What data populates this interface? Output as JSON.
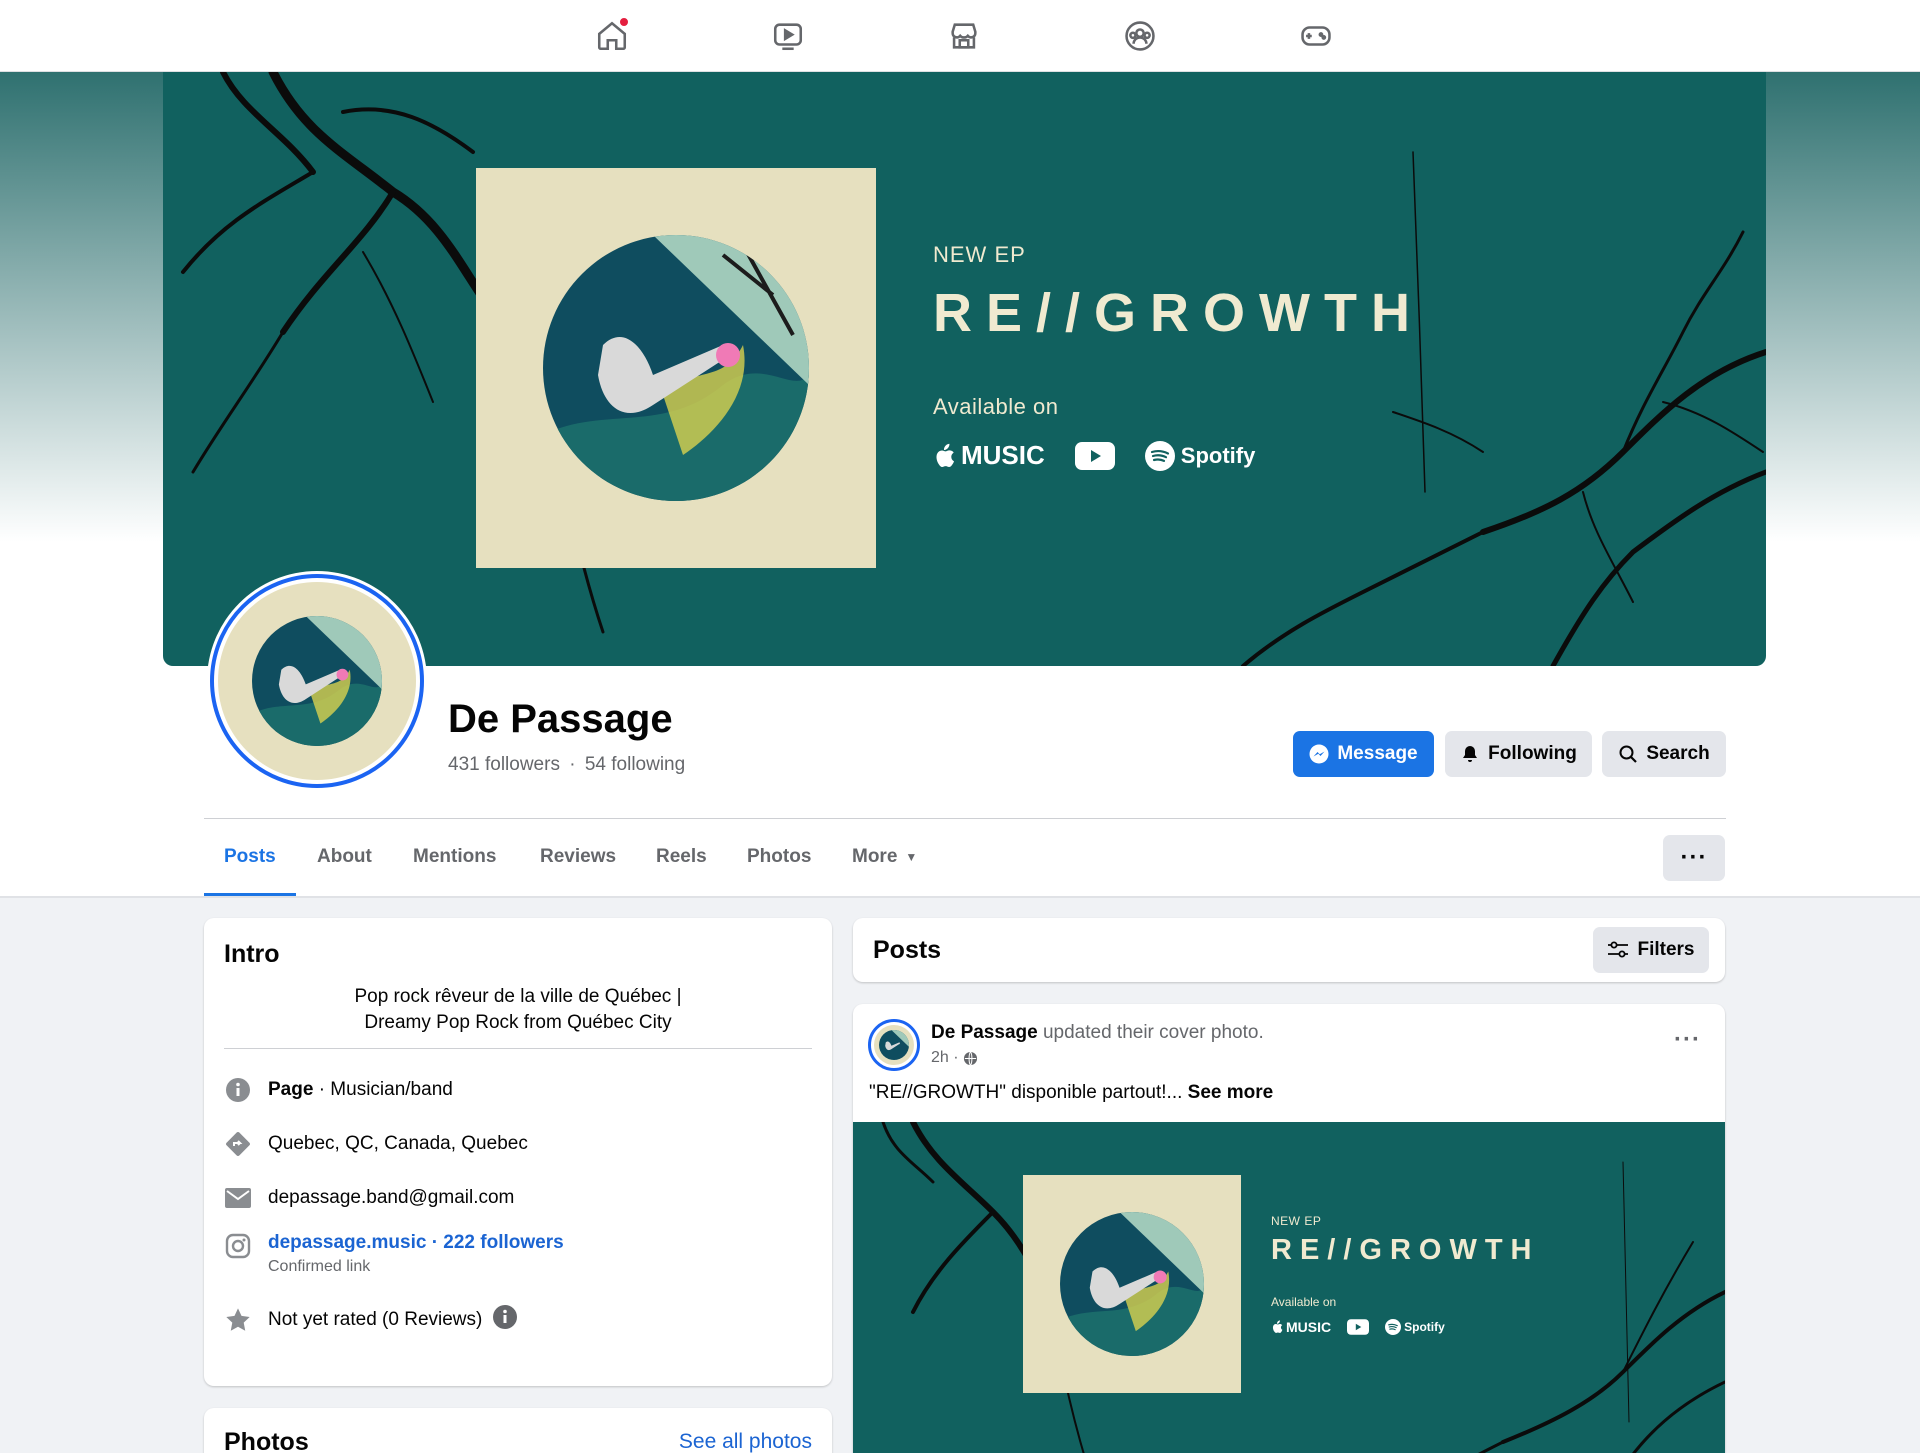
{
  "nav": {
    "icons": [
      "home-icon",
      "video-icon",
      "marketplace-icon",
      "groups-icon",
      "gaming-icon"
    ]
  },
  "cover": {
    "small": "NEW EP",
    "title": "RE//GROWTH",
    "available": "Available on",
    "music_label": "MUSIC",
    "spotify_label": "Spotify"
  },
  "profile": {
    "name": "De Passage",
    "followers": "431 followers",
    "dot": "·",
    "following": "54 following"
  },
  "actions": {
    "message": "Message",
    "following": "Following",
    "search": "Search"
  },
  "tabs": [
    "Posts",
    "About",
    "Mentions",
    "Reviews",
    "Reels",
    "Photos",
    "More"
  ],
  "intro": {
    "title": "Intro",
    "bio_line1": "Pop rock rêveur de la ville de Québec |",
    "bio_line2": "Dreamy Pop Rock from Québec City",
    "page_label": "Page",
    "page_category": " · Musician/band",
    "location": "Quebec, QC, Canada, Quebec",
    "email": "depassage.band@gmail.com",
    "instagram": "depassage.music · 222 followers",
    "confirmed": "Confirmed link",
    "rating": "Not yet rated (0 Reviews)"
  },
  "photos_card": {
    "title": "Photos",
    "see_all": "See all photos"
  },
  "posts_header": {
    "title": "Posts",
    "filters": "Filters"
  },
  "post": {
    "author": "De Passage",
    "action": " updated their cover photo.",
    "time": "2h ·",
    "text": "\"RE//GROWTH\" disponible partout!... ",
    "see_more": "See more"
  },
  "colors": {
    "accent": "#1b74e4",
    "cover_teal": "#11615f",
    "album_cream": "#e6e0bf"
  }
}
